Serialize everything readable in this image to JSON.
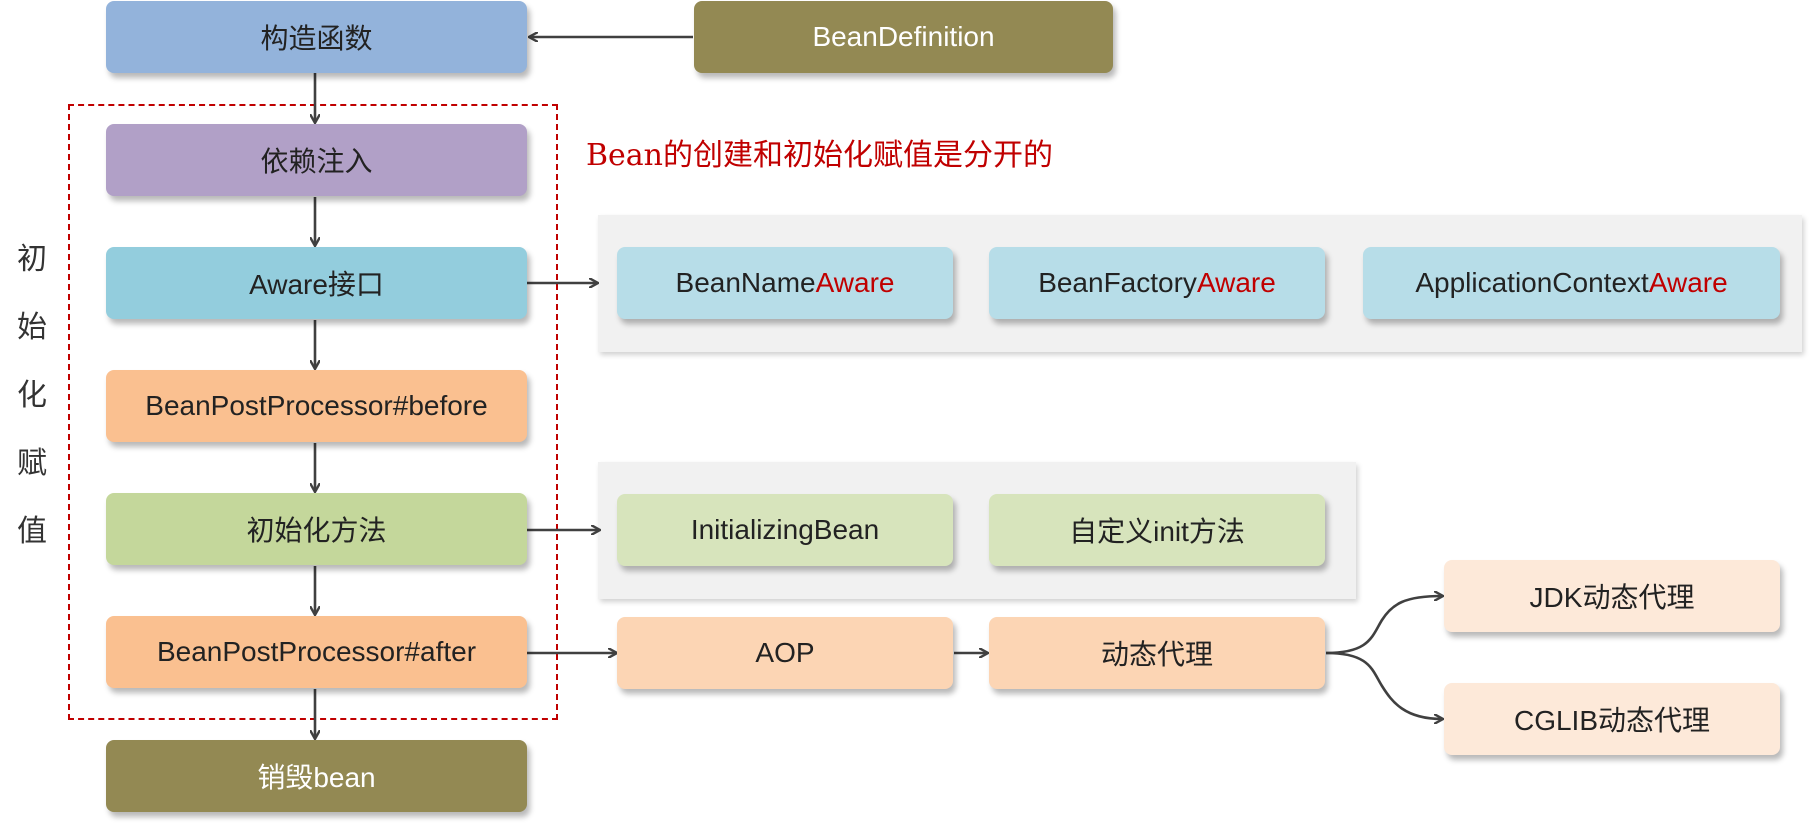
{
  "colors": {
    "blue": "#93b3db",
    "olive": "#938953",
    "purple": "#b1a0c7",
    "teal": "#93cddd",
    "orange": "#fac090",
    "green": "#c4d79b",
    "light_blue": "#b7dde8",
    "light_green": "#d7e4bc",
    "peach": "#fcd5b4",
    "light_peach": "#fde9d9",
    "highlight_red": "#c00000",
    "arrow": "#404040"
  },
  "main_flow": {
    "constructor": "构造函数",
    "dependency_injection": "依赖注入",
    "aware_interface": "Aware接口",
    "post_processor_before": "BeanPostProcessor#before",
    "init_method": "初始化方法",
    "post_processor_after": "BeanPostProcessor#after",
    "destroy_bean": "销毁bean"
  },
  "bean_definition": "BeanDefinition",
  "note": "Bean的创建和初始化赋值是分开的",
  "init_phase_label": [
    "初",
    "始",
    "化",
    "赋",
    "值"
  ],
  "aware_group": [
    {
      "prefix": "BeanName",
      "suffix": "Aware"
    },
    {
      "prefix": "BeanFactory",
      "suffix": "Aware"
    },
    {
      "prefix": "ApplicationContext",
      "suffix": "Aware"
    }
  ],
  "init_group": {
    "initializing_bean": "InitializingBean",
    "custom_init": "自定义init方法"
  },
  "aop_chain": {
    "aop": "AOP",
    "dynamic_proxy": "动态代理",
    "jdk_proxy": "JDK动态代理",
    "cglib_proxy": "CGLIB动态代理"
  }
}
